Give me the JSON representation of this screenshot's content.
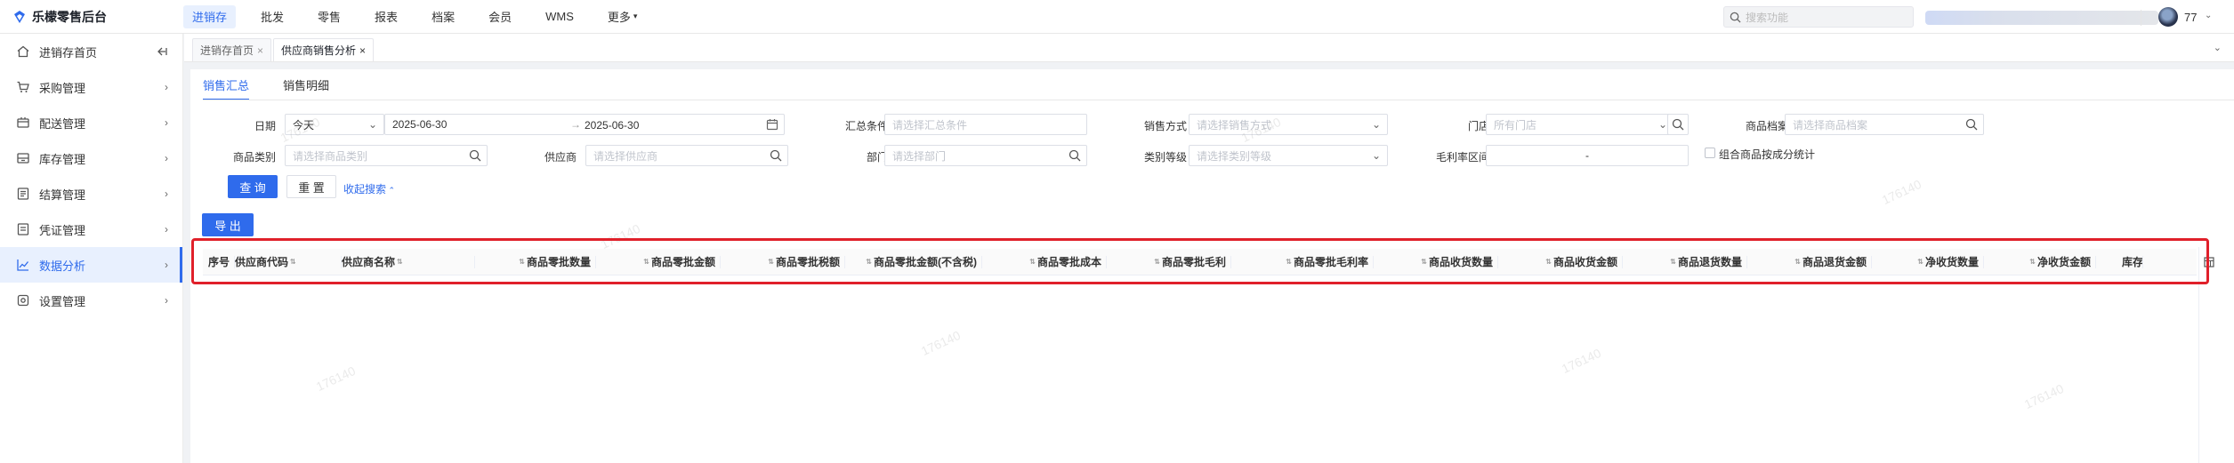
{
  "brand": {
    "name": "乐檬零售后台"
  },
  "top_nav": [
    {
      "label": "进销存",
      "active": true
    },
    {
      "label": "批发",
      "active": false
    },
    {
      "label": "零售",
      "active": false
    },
    {
      "label": "报表",
      "active": false
    },
    {
      "label": "档案",
      "active": false
    },
    {
      "label": "会员",
      "active": false
    },
    {
      "label": "WMS",
      "active": false
    },
    {
      "label": "更多",
      "active": false
    }
  ],
  "top_search": {
    "placeholder": "搜索功能"
  },
  "user": {
    "id": "77"
  },
  "sidebar": {
    "items": [
      {
        "label": "进销存首页",
        "icon": "home-icon"
      },
      {
        "label": "采购管理",
        "icon": "cart-icon"
      },
      {
        "label": "配送管理",
        "icon": "delivery-icon"
      },
      {
        "label": "库存管理",
        "icon": "inventory-icon"
      },
      {
        "label": "结算管理",
        "icon": "settlement-icon"
      },
      {
        "label": "凭证管理",
        "icon": "voucher-icon"
      },
      {
        "label": "数据分析",
        "icon": "chart-icon",
        "active": true
      },
      {
        "label": "设置管理",
        "icon": "settings-icon"
      }
    ]
  },
  "page_tabs": [
    {
      "label": "进销存首页"
    },
    {
      "label": "供应商销售分析",
      "active": true
    }
  ],
  "sub_tabs": [
    {
      "label": "销售汇总",
      "active": true
    },
    {
      "label": "销售明细"
    }
  ],
  "filters": {
    "date": {
      "label": "日期",
      "preset": "今天",
      "start": "2025-06-30",
      "end": "2025-06-30",
      "arrow": "→"
    },
    "summary": {
      "label": "汇总条件",
      "placeholder": "请选择汇总条件"
    },
    "sale_method": {
      "label": "销售方式",
      "placeholder": "请选择销售方式"
    },
    "store": {
      "label": "门店",
      "placeholder": "所有门店"
    },
    "product_archive": {
      "label": "商品档案",
      "placeholder": "请选择商品档案"
    },
    "category": {
      "label": "商品类别",
      "placeholder": "请选择商品类别"
    },
    "supplier": {
      "label": "供应商",
      "placeholder": "请选择供应商"
    },
    "department": {
      "label": "部门",
      "placeholder": "请选择部门"
    },
    "category_level": {
      "label": "类别等级",
      "placeholder": "请选择类别等级"
    },
    "margin_range": {
      "label": "毛利率区间",
      "sep": "-"
    },
    "combo_split": {
      "label": "组合商品按成分统计"
    }
  },
  "actions": {
    "query": "查 询",
    "reset": "重 置",
    "collapse": "收起搜索",
    "export": "导 出"
  },
  "table": {
    "columns": [
      "序号",
      "供应商代码",
      "供应商名称",
      "商品零批数量",
      "商品零批金额",
      "商品零批税额",
      "商品零批金额(不含税)",
      "商品零批成本",
      "商品零批毛利",
      "商品零批毛利率",
      "商品收货数量",
      "商品收货金额",
      "商品退货数量",
      "商品退货金额",
      "净收货数量",
      "净收货金额",
      "库存"
    ]
  },
  "watermark": "176140"
}
